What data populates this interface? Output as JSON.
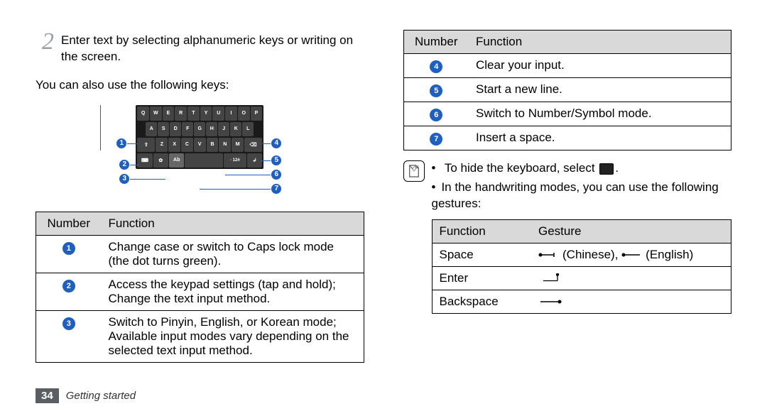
{
  "left": {
    "step_number": "2",
    "step_text_line1": "Enter text by selecting alphanumeric keys or writing",
    "step_text_line2": "on the screen.",
    "following_keys_intro": "You can also use the following keys:",
    "keyboard": {
      "row1": [
        "Q",
        "W",
        "E",
        "R",
        "T",
        "Y",
        "U",
        "I",
        "O",
        "P"
      ],
      "row2": [
        "A",
        "S",
        "D",
        "F",
        "G",
        "H",
        "J",
        "K",
        "L"
      ],
      "row3_shift_icon": "shift-icon",
      "row3_keys": [
        "Z",
        "X",
        "C",
        "V",
        "B",
        "N",
        "M"
      ],
      "row3_backspace_icon": "backspace-icon",
      "row4": {
        "hide_icon": "⌨",
        "gear_icon": "✿",
        "mode": "Ab",
        "space": "",
        "symnum": "·  12#",
        "enter_icon": "↲"
      },
      "callouts": {
        "1": "1",
        "2": "2",
        "3": "3",
        "4": "4",
        "5": "5",
        "6": "6",
        "7": "7"
      }
    },
    "table_headers": {
      "number": "Number",
      "function": "Function"
    },
    "rows": [
      {
        "n": "1",
        "f": "Change case or switch to Caps lock mode (the dot turns green)."
      },
      {
        "n": "2",
        "f": "Access the keypad settings (tap and hold); Change the text input method."
      },
      {
        "n": "3",
        "f": "Switch to Pinyin, English, or Korean mode; Available input modes vary depending on the selected text input method."
      }
    ]
  },
  "right": {
    "table_headers": {
      "number": "Number",
      "function": "Function"
    },
    "rows": [
      {
        "n": "4",
        "f": "Clear your input."
      },
      {
        "n": "5",
        "f": "Start a new line."
      },
      {
        "n": "6",
        "f": "Switch to Number/Symbol mode."
      },
      {
        "n": "7",
        "f": "Insert a space."
      }
    ],
    "note_bullet1_prefix": "To hide the keyboard, select",
    "note_bullet1_suffix": ".",
    "note_bullet2": "In the handwriting modes, you can use the following gestures:",
    "gesture_headers": {
      "function": "Function",
      "gesture": "Gesture"
    },
    "gestures": [
      {
        "f": "Space",
        "labels": {
          "chinese": "(Chinese),",
          "english": "(English)"
        }
      },
      {
        "f": "Enter"
      },
      {
        "f": "Backspace"
      }
    ]
  },
  "footer": {
    "page": "34",
    "section": "Getting started"
  }
}
